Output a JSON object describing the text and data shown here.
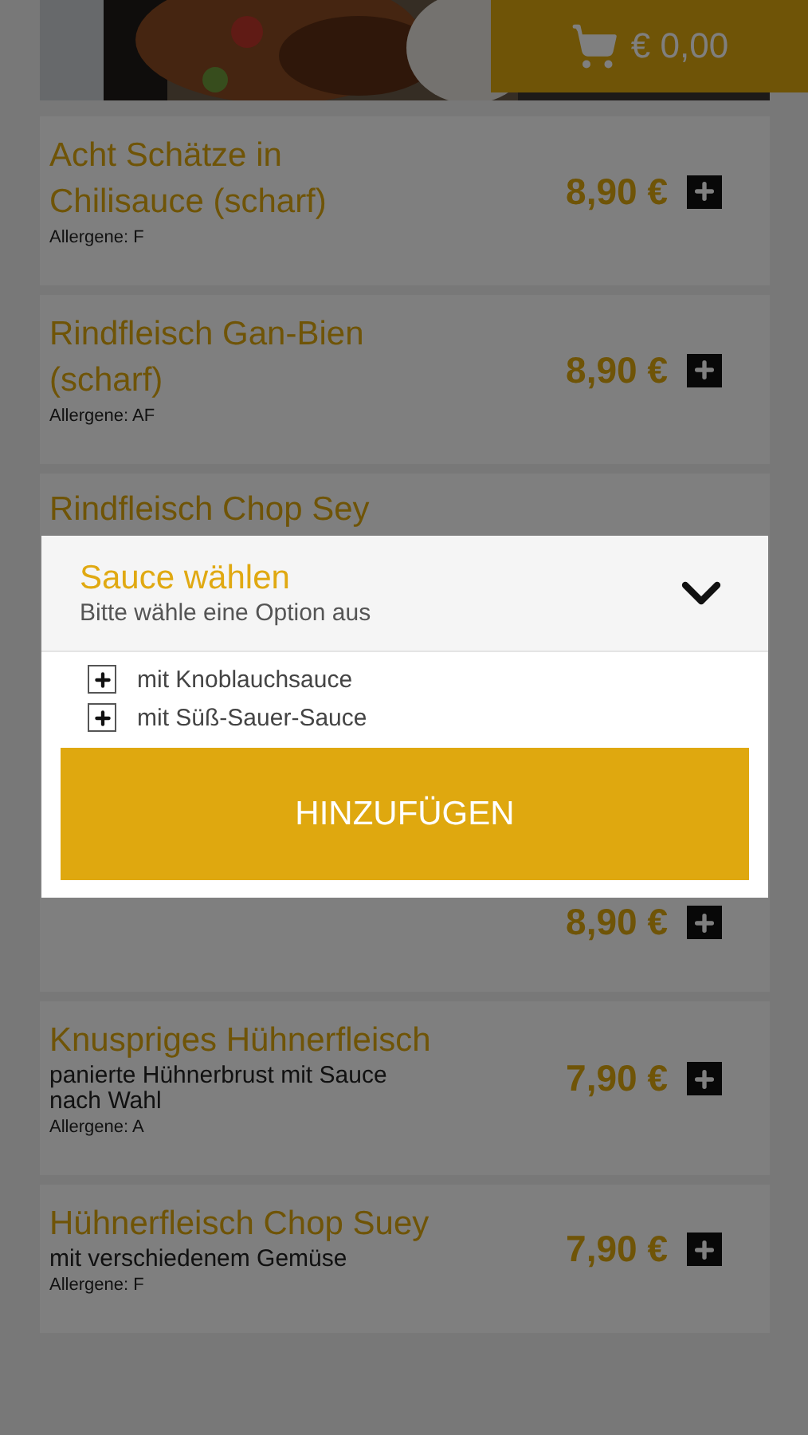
{
  "cart": {
    "total": "€ 0,00"
  },
  "dishes": [
    {
      "name": "Acht Schätze in Chilisauce (scharf)",
      "allergens": "Allergene: F",
      "price": "8,90 €"
    },
    {
      "name": "Rindfleisch Gan-Bien (scharf)",
      "allergens": "Allergene: AF",
      "price": "8,90 €"
    },
    {
      "name": "Rindfleisch Chop Sey",
      "price": "8,90 €"
    },
    {
      "name": "Knuspriges Hühnerfleisch",
      "description": "panierte Hühnerbrust mit Sauce nach Wahl",
      "allergens": "Allergene: A",
      "price": "7,90 €"
    },
    {
      "name": "Hühnerfleisch Chop Suey",
      "description": "mit verschiedenem Gemüse",
      "allergens": "Allergene: F",
      "price": "7,90 €"
    }
  ],
  "dialog": {
    "title": "Sauce wählen",
    "subtitle": "Bitte wähle eine Option aus",
    "expanded": true,
    "options": [
      {
        "label": "mit Knoblauchsauce"
      },
      {
        "label": "mit Süß-Sauer-Sauce"
      }
    ],
    "button": "HINZUFÜGEN"
  }
}
